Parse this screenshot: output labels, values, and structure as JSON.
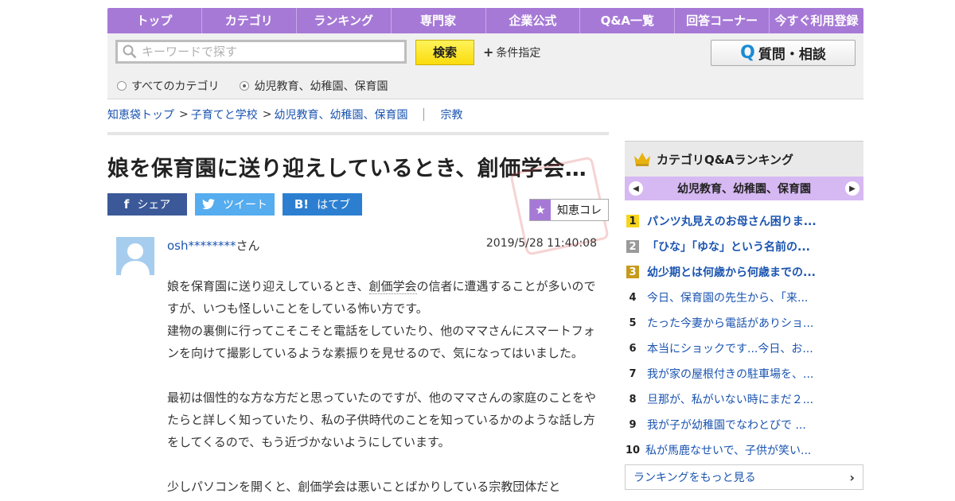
{
  "nav": [
    "トップ",
    "カテゴリ",
    "ランキング",
    "専門家",
    "企業公式",
    "Q&A一覧",
    "回答コーナー",
    "今すぐ利用登録"
  ],
  "search": {
    "placeholder": "キーワードで探す",
    "button": "検索",
    "conditions": "条件指定",
    "ask_button": "質問・相談",
    "radios": [
      {
        "label": "すべてのカテゴリ",
        "selected": false
      },
      {
        "label": "幼児教育、幼稚園、保育園",
        "selected": true
      }
    ]
  },
  "breadcrumb": [
    "知恵袋トップ",
    "子育てと学校",
    "幼児教育、幼稚園、保育園"
  ],
  "breadcrumb_extra": "宗教",
  "question": {
    "title": "娘を保育園に送り迎えしているとき、創価学会…",
    "share": {
      "facebook": "シェア",
      "twitter": "ツイート",
      "hatena": "はてブ"
    },
    "collection": "知恵コレ",
    "user": "osh********",
    "user_suffix": "さん",
    "date": "2019/5/28  11:40:08",
    "body": {
      "p1_pre": "娘を保育園に送り迎えしているとき、",
      "p1_link": "創価学会",
      "p1_post": "の信者に遭遇することが多いのですが、いつも怪しいことをしている怖い方です。",
      "p2": "建物の裏側に行ってこそこそと電話をしていたり、他のママさんにスマートフォンを向けて撮影しているような素振りを見せるので、気になってはいました。",
      "p3": "最初は個性的な方な方だと思っていたのですが、他のママさんの家庭のことをやたらと詳しく知っていたり、私の子供時代のことを知っているかのような話し方をしてくるので、もう近づかないようにしています。",
      "p4": "少しパソコンを開くと、創価学会は悪いことばかりしている宗教団体だと"
    }
  },
  "sidebar": {
    "heading": "カテゴリQ&Aランキング",
    "category": "幼児教育、幼稚園、保育園",
    "ranking": [
      {
        "no": "1",
        "title": "パンツ丸見えのお母さん困りま..."
      },
      {
        "no": "2",
        "title": "「ひな」「ゆな」という名前の..."
      },
      {
        "no": "3",
        "title": "幼少期とは何歳から何歳までの..."
      },
      {
        "no": "4",
        "title": "今日、保育園の先生から、「来..."
      },
      {
        "no": "5",
        "title": "たった今妻から電話がありショ..."
      },
      {
        "no": "6",
        "title": "本当にショックです...今日、お..."
      },
      {
        "no": "7",
        "title": "我が家の屋根付きの駐車場を、..."
      },
      {
        "no": "8",
        "title": "旦那が、私がいない時にまだ２..."
      },
      {
        "no": "9",
        "title": "我が子が幼稚園でなわとびで ..."
      },
      {
        "no": "10",
        "title": "私が馬鹿なせいで、子供が笑い..."
      }
    ],
    "more": "ランキングをもっと見る"
  }
}
